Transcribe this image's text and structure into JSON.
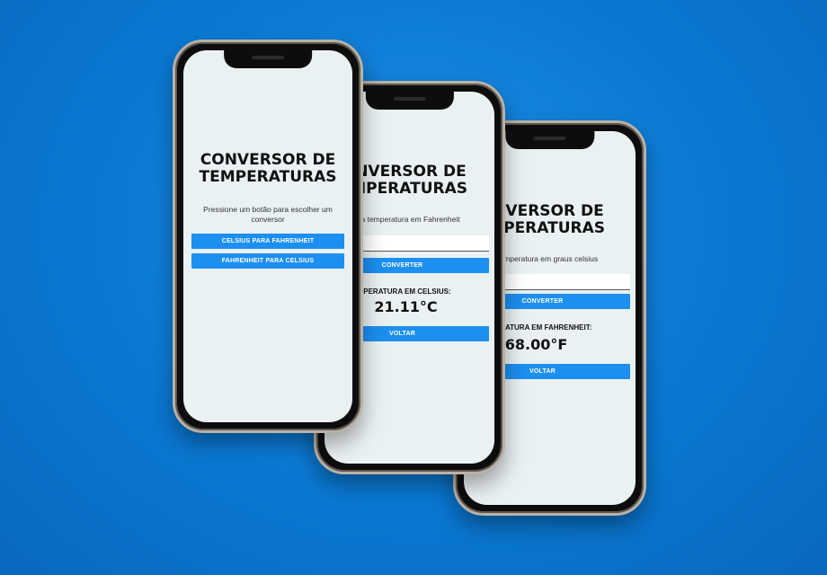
{
  "phone1": {
    "title_line1": "CONVERSOR DE",
    "title_line2": "TEMPERATURAS",
    "instruction_line1": "Pressione um botão para escolher um",
    "instruction_line2": "conversor",
    "btn_c_to_f": "CELSIUS PARA FAHRENHEIT",
    "btn_f_to_c": "FAHRENHEIT PARA CELSIUS"
  },
  "phone2": {
    "title_line1": "CONVERSOR DE",
    "title_line2": "TEMPERATURAS",
    "prompt": "Digite a temperatura em Fahrenheit",
    "convert": "CONVERTER",
    "result_label": "TEMPERATURA EM CELSIUS:",
    "result_value": "21.11°C",
    "back": "VOLTAR"
  },
  "phone3": {
    "title_line1": "CONVERSOR DE",
    "title_line2": "TEMPERATURAS",
    "prompt": "Digite a temperatura em graus celsius",
    "convert": "CONVERTER",
    "result_label": "TEMPERATURA EM FAHRENHEIT:",
    "result_value": "68.00°F",
    "back": "VOLTAR"
  },
  "colors": {
    "background": "#0a78d2",
    "button": "#1c8ff0",
    "screen": "#eaf1f2"
  }
}
